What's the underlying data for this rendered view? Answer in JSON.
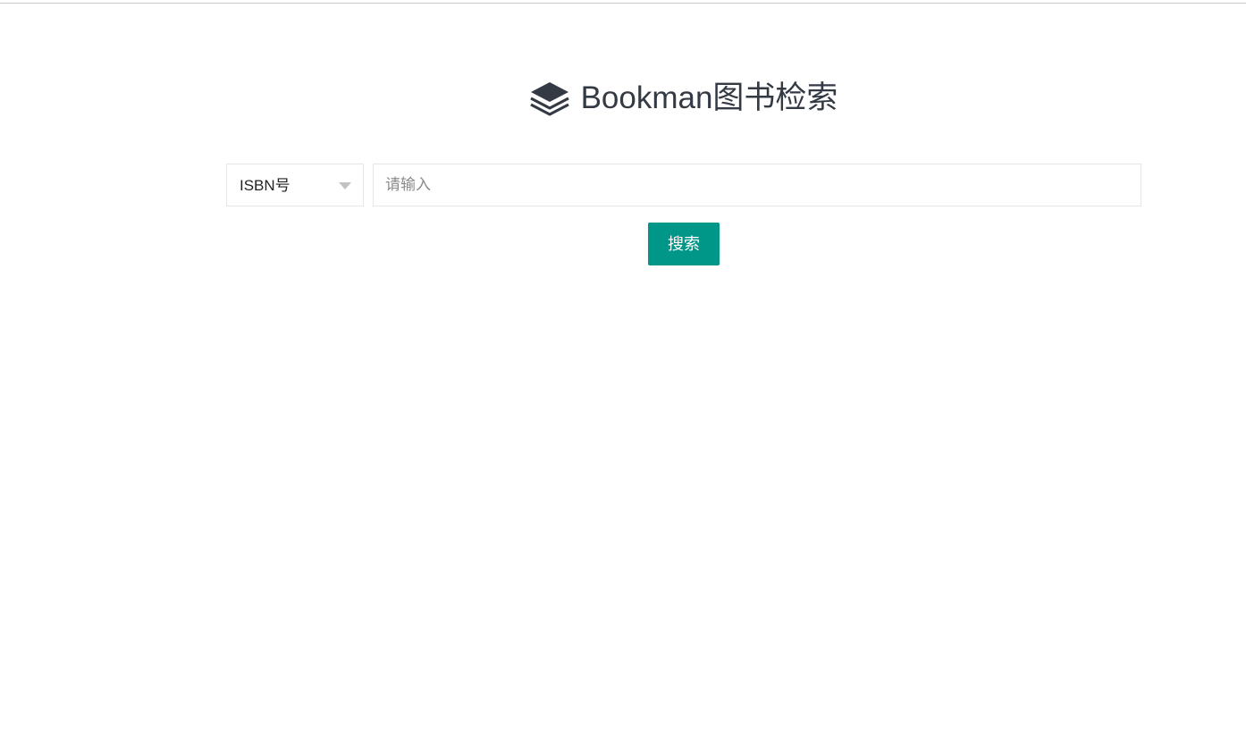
{
  "header": {
    "title": "Bookman图书检索",
    "logo_icon": "layers-stack-icon"
  },
  "search": {
    "type_select": {
      "selected": "ISBN号",
      "icon": "caret-down-icon"
    },
    "input": {
      "value": "",
      "placeholder": "请输入"
    },
    "button_label": "搜索"
  },
  "colors": {
    "accent": "#009688",
    "title_text": "#333a44",
    "border": "#e6e6e6"
  }
}
